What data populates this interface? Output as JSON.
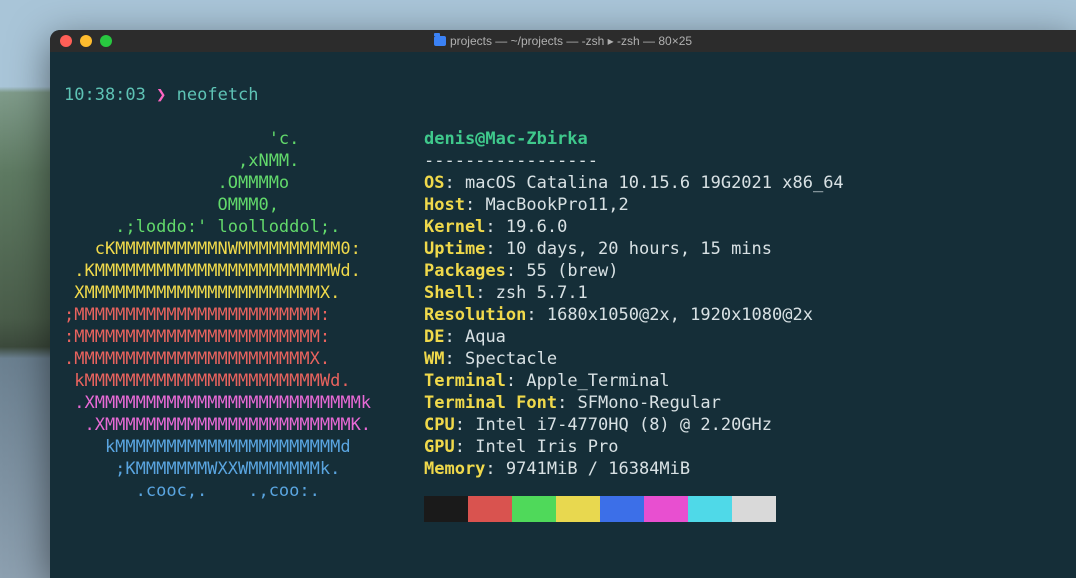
{
  "window": {
    "title": "projects — ~/projects — -zsh ▸ -zsh — 80×25"
  },
  "prompt": {
    "time": "10:38:03",
    "arrow": "❯",
    "command": "neofetch"
  },
  "ascii": {
    "l0": "                    'c.",
    "l1": "                 ,xNMM.",
    "l2": "               .OMMMMo",
    "l3": "               OMMM0,",
    "l4": "     .;loddo:' loolloddol;.",
    "l5": "   cKMMMMMMMMMMNWMMMMMMMMMM0:",
    "l6": " .KMMMMMMMMMMMMMMMMMMMMMMMWd.",
    "l7": " XMMMMMMMMMMMMMMMMMMMMMMMX.",
    "l8": ";MMMMMMMMMMMMMMMMMMMMMMMM:",
    "l9": ":MMMMMMMMMMMMMMMMMMMMMMMM:",
    "l10": ".MMMMMMMMMMMMMMMMMMMMMMMX.",
    "l11": " kMMMMMMMMMMMMMMMMMMMMMMMWd.",
    "l12": " .XMMMMMMMMMMMMMMMMMMMMMMMMMMk",
    "l13": "  .XMMMMMMMMMMMMMMMMMMMMMMMMK.",
    "l14": "    kMMMMMMMMMMMMMMMMMMMMMMd",
    "l15": "     ;KMMMMMMMWXXWMMMMMMMk.",
    "l16": "       .cooc,.    .,coo:."
  },
  "info": {
    "hostline": "denis@Mac-Zbirka",
    "separator": "-----------------",
    "os_label": "OS",
    "os_val": "macOS Catalina 10.15.6 19G2021 x86_64",
    "host_label": "Host",
    "host_val": "MacBookPro11,2",
    "kernel_label": "Kernel",
    "kernel_val": "19.6.0",
    "uptime_label": "Uptime",
    "uptime_val": "10 days, 20 hours, 15 mins",
    "packages_label": "Packages",
    "packages_val": "55 (brew)",
    "shell_label": "Shell",
    "shell_val": "zsh 5.7.1",
    "resolution_label": "Resolution",
    "resolution_val": "1680x1050@2x, 1920x1080@2x",
    "de_label": "DE",
    "de_val": "Aqua",
    "wm_label": "WM",
    "wm_val": "Spectacle",
    "terminal_label": "Terminal",
    "terminal_val": "Apple_Terminal",
    "font_label": "Terminal Font",
    "font_val": "SFMono-Regular",
    "cpu_label": "CPU",
    "cpu_val": "Intel i7-4770HQ (8) @ 2.20GHz",
    "gpu_label": "GPU",
    "gpu_val": "Intel Iris Pro",
    "memory_label": "Memory",
    "memory_val": "9741MiB / 16384MiB"
  },
  "swatches": [
    "#1a1a1a",
    "#d9534f",
    "#4fd95a",
    "#e8d84f",
    "#3c6fe8",
    "#e84fd0",
    "#4fd9e8",
    "#d9d9d9"
  ]
}
